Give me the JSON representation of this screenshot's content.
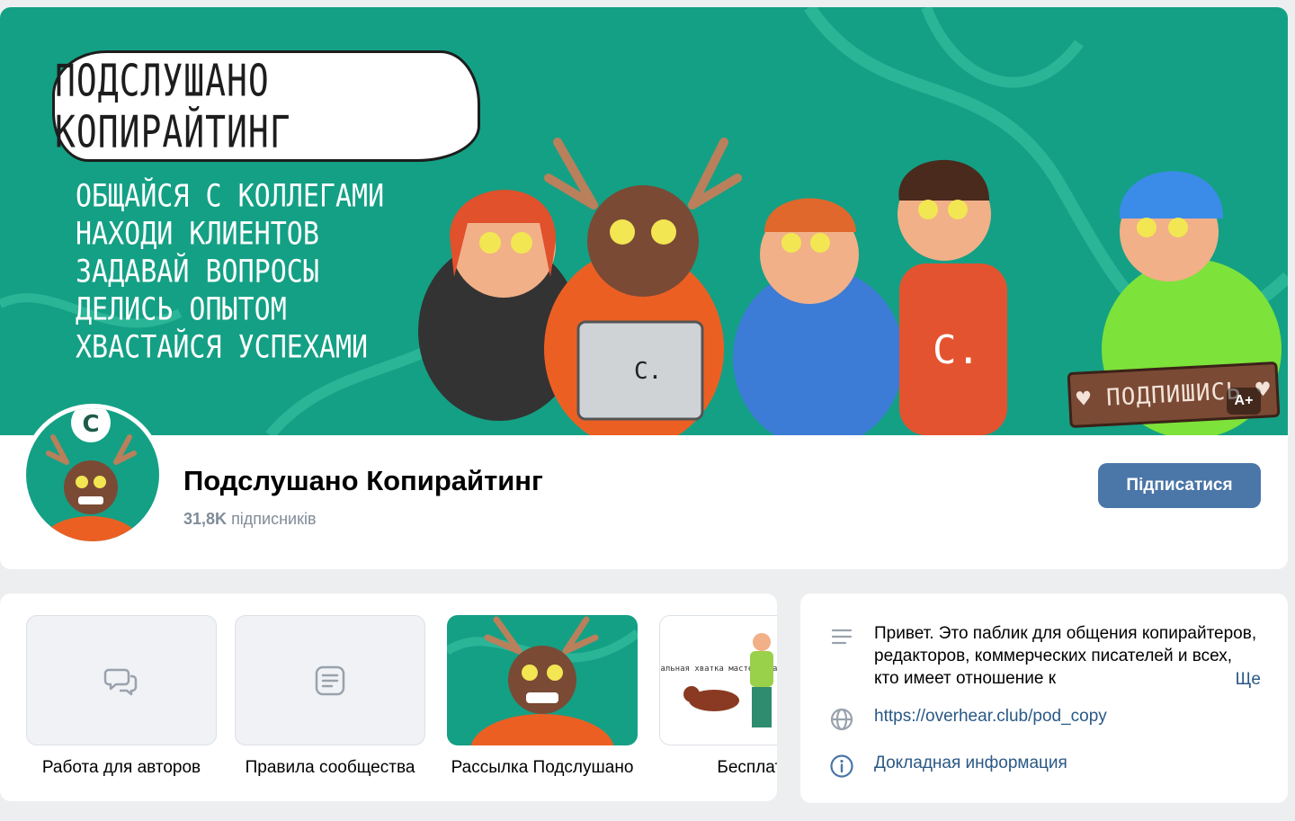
{
  "cover": {
    "title": "Подслушано Копирайтинг",
    "lines": [
      "Общайся с коллегами",
      "Находи клиентов",
      "Задавай вопросы",
      "Делись опытом",
      "Хвастайся успехами"
    ],
    "laptop_letter": "C.",
    "shirt_letter": "C.",
    "sign_text": "♥ Подпишись ♥",
    "badge": "A+"
  },
  "group": {
    "name": "Подслушано Копирайтинг",
    "subscribers_count": "31,8K",
    "subscribers_label": "підписників",
    "subscribe_label": "Підписатися"
  },
  "links": [
    {
      "label": "Работа для авторов",
      "icon": "chat-icon"
    },
    {
      "label": "Правила сообщества",
      "icon": "article-icon"
    },
    {
      "label": "Рассылка Подслушано",
      "icon": "deer-image"
    },
    {
      "label": "Бесплатн",
      "icon": "mastery-image",
      "image_text": "Стальная хватка мастерства"
    }
  ],
  "info": {
    "description": "Привет. Это паблик для общения копирайтеров, редакторов, коммерческих писателей и всех, кто имеет отношение к",
    "more_label": "Ще",
    "url": "https://overhear.club/pod_copy",
    "details_label": "Докладная информация"
  },
  "colors": {
    "cover_green": "#14a085",
    "accent_blue": "#4a76a8",
    "link_blue": "#2a5885",
    "muted": "#818c99"
  }
}
